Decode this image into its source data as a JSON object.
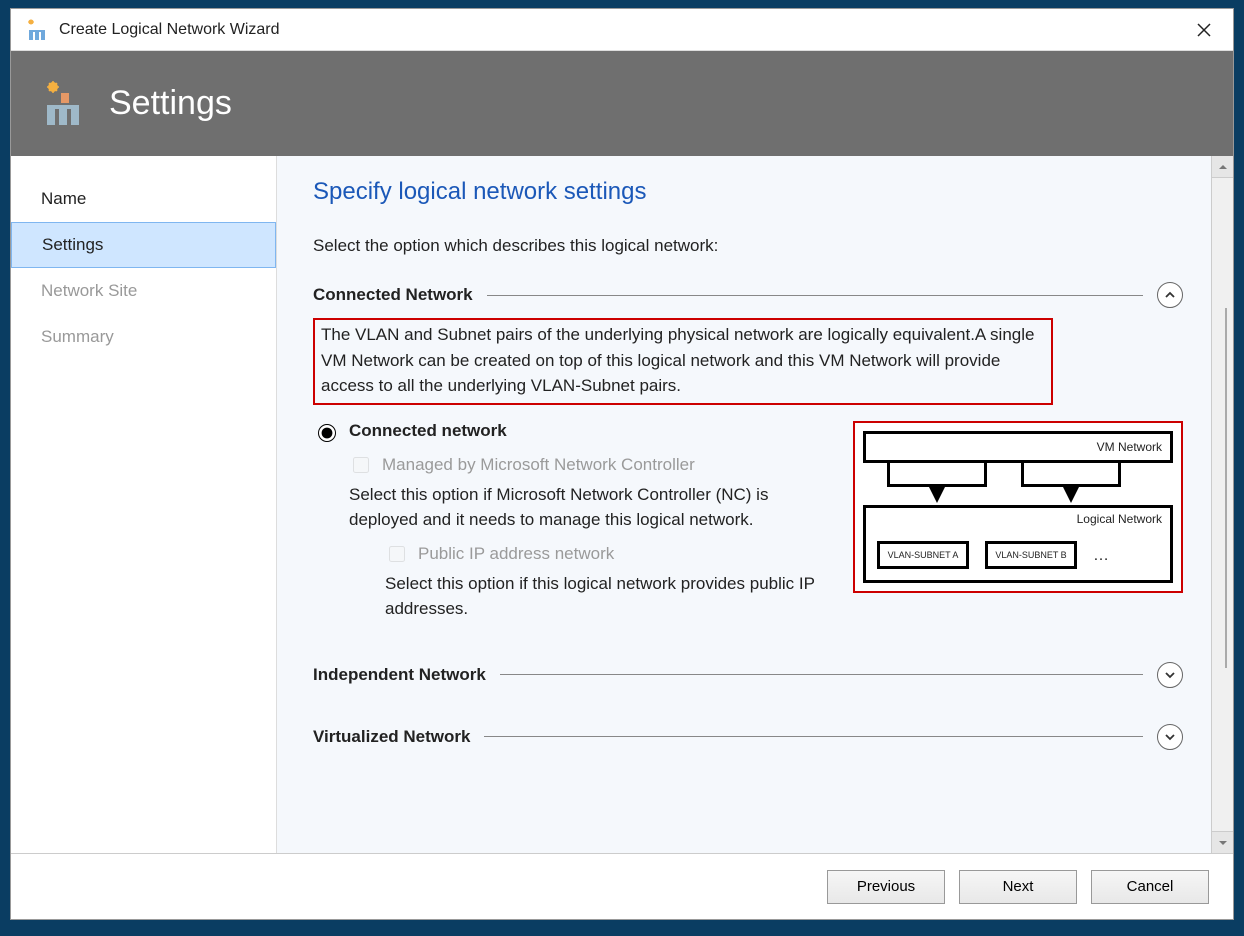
{
  "window": {
    "title": "Create Logical Network Wizard"
  },
  "banner": {
    "title": "Settings"
  },
  "sidebar": {
    "items": [
      {
        "label": "Name",
        "selected": false
      },
      {
        "label": "Settings",
        "selected": true
      },
      {
        "label": "Network Site",
        "selected": false
      },
      {
        "label": "Summary",
        "selected": false
      }
    ]
  },
  "page": {
    "heading": "Specify logical network settings",
    "instruction": "Select the option which describes this logical network:",
    "sections": {
      "connected": {
        "title": "Connected Network",
        "expanded": true,
        "description": "The VLAN and Subnet pairs of the underlying physical network are logically equivalent.A single VM Network can be created on top of this logical network and this VM Network will provide access to all the underlying VLAN-Subnet pairs.",
        "radio_label": "Connected network",
        "cb1_label": "Managed by Microsoft Network Controller",
        "cb1_desc": "Select this option if Microsoft Network Controller (NC) is deployed and it needs to manage this logical network.",
        "cb2_label": "Public IP address network",
        "cb2_desc": "Select this option if this logical network provides public IP addresses.",
        "diagram": {
          "vm_network": "VM Network",
          "logical_network": "Logical Network",
          "subnet_a": "VLAN-SUBNET A",
          "subnet_b": "VLAN-SUBNET B",
          "dots": "…"
        }
      },
      "independent": {
        "title": "Independent Network",
        "expanded": false
      },
      "virtualized": {
        "title": "Virtualized Network",
        "expanded": false
      }
    }
  },
  "footer": {
    "previous": "Previous",
    "next": "Next",
    "cancel": "Cancel"
  }
}
